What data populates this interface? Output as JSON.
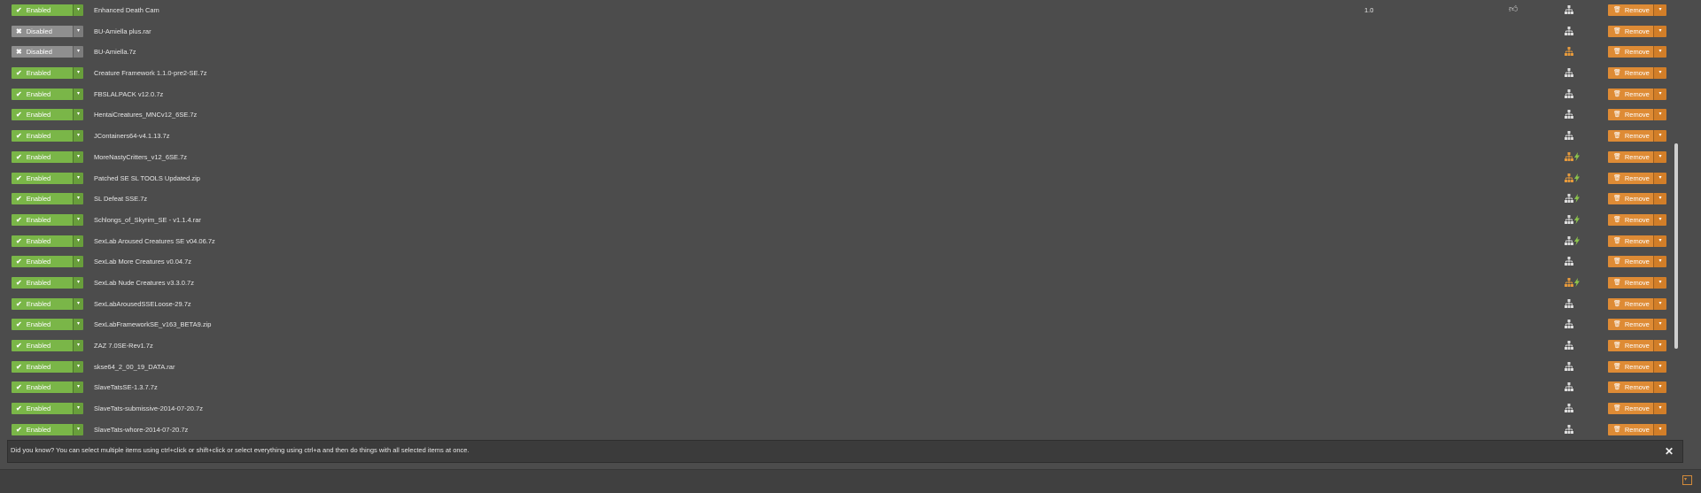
{
  "colors": {
    "background": "#4c4c4c",
    "enabled": "#7ab648",
    "disabled": "#8f8f8f",
    "remove": "#de8b35",
    "dep_ok": "#dddddd",
    "dep_warn": "#e69a3c",
    "lightning": "#8bc34a"
  },
  "mods": [
    {
      "status": "Enabled",
      "name": "Enhanced Death Cam",
      "version": "1.0",
      "endorse": true,
      "dep": "ok",
      "bolt": false,
      "remove": "Remove"
    },
    {
      "status": "Disabled",
      "name": "BU-Amiella plus.rar",
      "version": "",
      "endorse": false,
      "dep": "ok",
      "bolt": false,
      "remove": "Remove"
    },
    {
      "status": "Disabled",
      "name": "BU-Amiella.7z",
      "version": "",
      "endorse": false,
      "dep": "warn",
      "bolt": false,
      "remove": "Remove"
    },
    {
      "status": "Enabled",
      "name": "Creature Framework 1.1.0-pre2-SE.7z",
      "version": "",
      "endorse": false,
      "dep": "ok",
      "bolt": false,
      "remove": "Remove"
    },
    {
      "status": "Enabled",
      "name": "FBSLALPACK v12.0.7z",
      "version": "",
      "endorse": false,
      "dep": "ok",
      "bolt": false,
      "remove": "Remove"
    },
    {
      "status": "Enabled",
      "name": "HentaiCreatures_MNCv12_6SE.7z",
      "version": "",
      "endorse": false,
      "dep": "ok",
      "bolt": false,
      "remove": "Remove"
    },
    {
      "status": "Enabled",
      "name": "JContainers64-v4.1.13.7z",
      "version": "",
      "endorse": false,
      "dep": "ok",
      "bolt": false,
      "remove": "Remove"
    },
    {
      "status": "Enabled",
      "name": "MoreNastyCritters_v12_6SE.7z",
      "version": "",
      "endorse": false,
      "dep": "warn",
      "bolt": true,
      "remove": "Remove"
    },
    {
      "status": "Enabled",
      "name": "Patched SE SL TOOLS Updated.zip",
      "version": "",
      "endorse": false,
      "dep": "warn",
      "bolt": true,
      "remove": "Remove"
    },
    {
      "status": "Enabled",
      "name": "SL Defeat SSE.7z",
      "version": "",
      "endorse": false,
      "dep": "ok",
      "bolt": true,
      "remove": "Remove"
    },
    {
      "status": "Enabled",
      "name": "Schlongs_of_Skyrim_SE - v1.1.4.rar",
      "version": "",
      "endorse": false,
      "dep": "ok",
      "bolt": true,
      "remove": "Remove"
    },
    {
      "status": "Enabled",
      "name": "SexLab Aroused Creatures SE v04.06.7z",
      "version": "",
      "endorse": false,
      "dep": "ok",
      "bolt": true,
      "remove": "Remove"
    },
    {
      "status": "Enabled",
      "name": "SexLab More Creatures v0.04.7z",
      "version": "",
      "endorse": false,
      "dep": "ok",
      "bolt": false,
      "remove": "Remove"
    },
    {
      "status": "Enabled",
      "name": "SexLab Nude Creatures v3.3.0.7z",
      "version": "",
      "endorse": false,
      "dep": "warn",
      "bolt": true,
      "remove": "Remove"
    },
    {
      "status": "Enabled",
      "name": "SexLabArousedSSELoose-29.7z",
      "version": "",
      "endorse": false,
      "dep": "ok",
      "bolt": false,
      "remove": "Remove"
    },
    {
      "status": "Enabled",
      "name": "SexLabFrameworkSE_v163_BETA9.zip",
      "version": "",
      "endorse": false,
      "dep": "ok",
      "bolt": false,
      "remove": "Remove"
    },
    {
      "status": "Enabled",
      "name": "ZAZ 7.0SE-Rev1.7z",
      "version": "",
      "endorse": false,
      "dep": "ok",
      "bolt": false,
      "remove": "Remove"
    },
    {
      "status": "Enabled",
      "name": "skse64_2_00_19_DATA.rar",
      "version": "",
      "endorse": false,
      "dep": "ok",
      "bolt": false,
      "remove": "Remove"
    },
    {
      "status": "Enabled",
      "name": "SlaveTatsSE-1.3.7.7z",
      "version": "",
      "endorse": false,
      "dep": "ok",
      "bolt": false,
      "remove": "Remove"
    },
    {
      "status": "Enabled",
      "name": "SlaveTats-submissive-2014-07-20.7z",
      "version": "",
      "endorse": false,
      "dep": "ok",
      "bolt": false,
      "remove": "Remove"
    },
    {
      "status": "Enabled",
      "name": "SlaveTats-whore-2014-07-20.7z",
      "version": "",
      "endorse": false,
      "dep": "ok",
      "bolt": false,
      "remove": "Remove"
    }
  ],
  "tip": {
    "text": "Did you know? You can select multiple items using ctrl+click or shift+click or select everything using ctrl+a and then do things with all selected items at once."
  },
  "icons": {
    "enabled": "check-icon",
    "disabled": "x-icon",
    "endorse": "thumbs-up-icon",
    "dependency": "dependency-tree-icon",
    "lightning": "lightning-icon",
    "remove": "trash-icon",
    "dropdown": "caret-down-icon",
    "close": "close-icon"
  }
}
